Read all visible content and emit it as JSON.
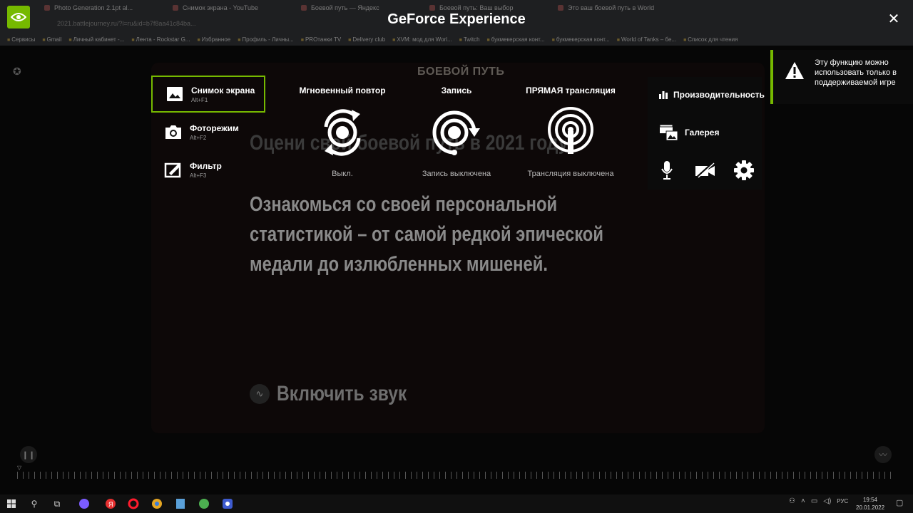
{
  "overlay": {
    "title": "GeForce Experience",
    "close_icon": "✕"
  },
  "sidebar": {
    "items": [
      {
        "label": "Снимок экрана",
        "hotkey": "Alt+F1",
        "icon": "image-icon",
        "active": true
      },
      {
        "label": "Фоторежим",
        "hotkey": "Alt+F2",
        "icon": "camera-icon",
        "active": false
      },
      {
        "label": "Фильтр",
        "hotkey": "Alt+F3",
        "icon": "filter-icon",
        "active": false
      }
    ]
  },
  "features": {
    "instant_replay": {
      "label": "Мгновенный повтор",
      "status": "Выкл."
    },
    "record": {
      "label": "Запись",
      "status": "Запись выключена"
    },
    "broadcast": {
      "label": "ПРЯМАЯ трансляция",
      "status": "Трансляция выключена"
    }
  },
  "right_panel": {
    "performance_label": "Производительность",
    "gallery_label": "Галерея",
    "icons": [
      "microphone-icon",
      "camera-off-icon",
      "settings-gear-icon"
    ]
  },
  "notice": {
    "text": "Эту функцию можно использовать только в поддерживаемой игре",
    "icon": "warning-icon"
  },
  "page": {
    "brand": "БОЕВОЙ ПУТЬ",
    "heading": "Оцени свой боевой путь в 2021 году!",
    "lead": "Ознакомься со своей персональной статистикой – от самой редкой эпической медали до излюбленных мишеней.",
    "sound_label": "Включить звук"
  },
  "browser": {
    "tabs": [
      "Photo Generation 2.1pt al...",
      "Снимок экрана - YouTube",
      "Боевой путь — Яндекс",
      "Боевой путь: Ваш выбор",
      "Это ваш боевой путь в World"
    ],
    "address": "2021.battlejourney.ru/?l=ru&id=b7f8aa41c84ba...",
    "bookmarks": [
      "Сервисы",
      "Gmail",
      "Личный кабинет -...",
      "Лента - Rockstar G...",
      "Избранное",
      "Профиль - Личны...",
      "PROтанки TV",
      "Delivery club",
      "XVM: мод для Worl...",
      "Twitch",
      "букмекерская конт...",
      "букмекерская конт...",
      "World of Tanks – бе...",
      "Список для чтения"
    ]
  },
  "taskbar": {
    "lang": "РУС",
    "time": "19:54",
    "date": "20.01.2022"
  },
  "colors": {
    "accent": "#76b900",
    "background": "#050505"
  }
}
